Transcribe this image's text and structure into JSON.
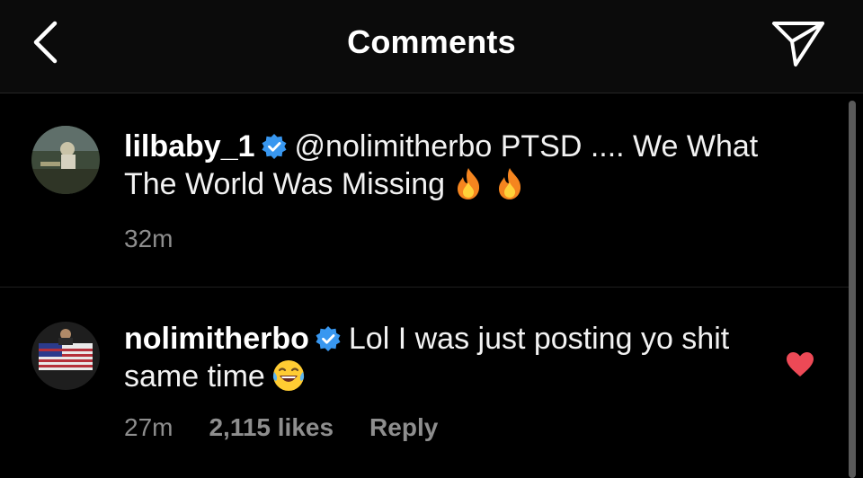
{
  "header": {
    "title": "Comments",
    "back_icon": "chevron-left-icon",
    "send_icon": "paper-plane-icon"
  },
  "comments": [
    {
      "username": "lilbaby_1",
      "verified": true,
      "mention": "@nolimitherbo",
      "text": " PTSD .... We What The World Was Missing",
      "emoji": "🔥🔥",
      "time": "32m"
    },
    {
      "username": "nolimitherbo",
      "verified": true,
      "text": "Lol I was just posting yo shit same time",
      "emoji": "😂",
      "time": "27m",
      "likes": "2,115 likes",
      "reply_label": "Reply",
      "liked": true
    }
  ],
  "colors": {
    "background": "#000000",
    "header_bg": "#0b0b0b",
    "verified_blue": "#3897f0",
    "like_red": "#ed4956",
    "meta_gray": "#8e8e8e"
  }
}
